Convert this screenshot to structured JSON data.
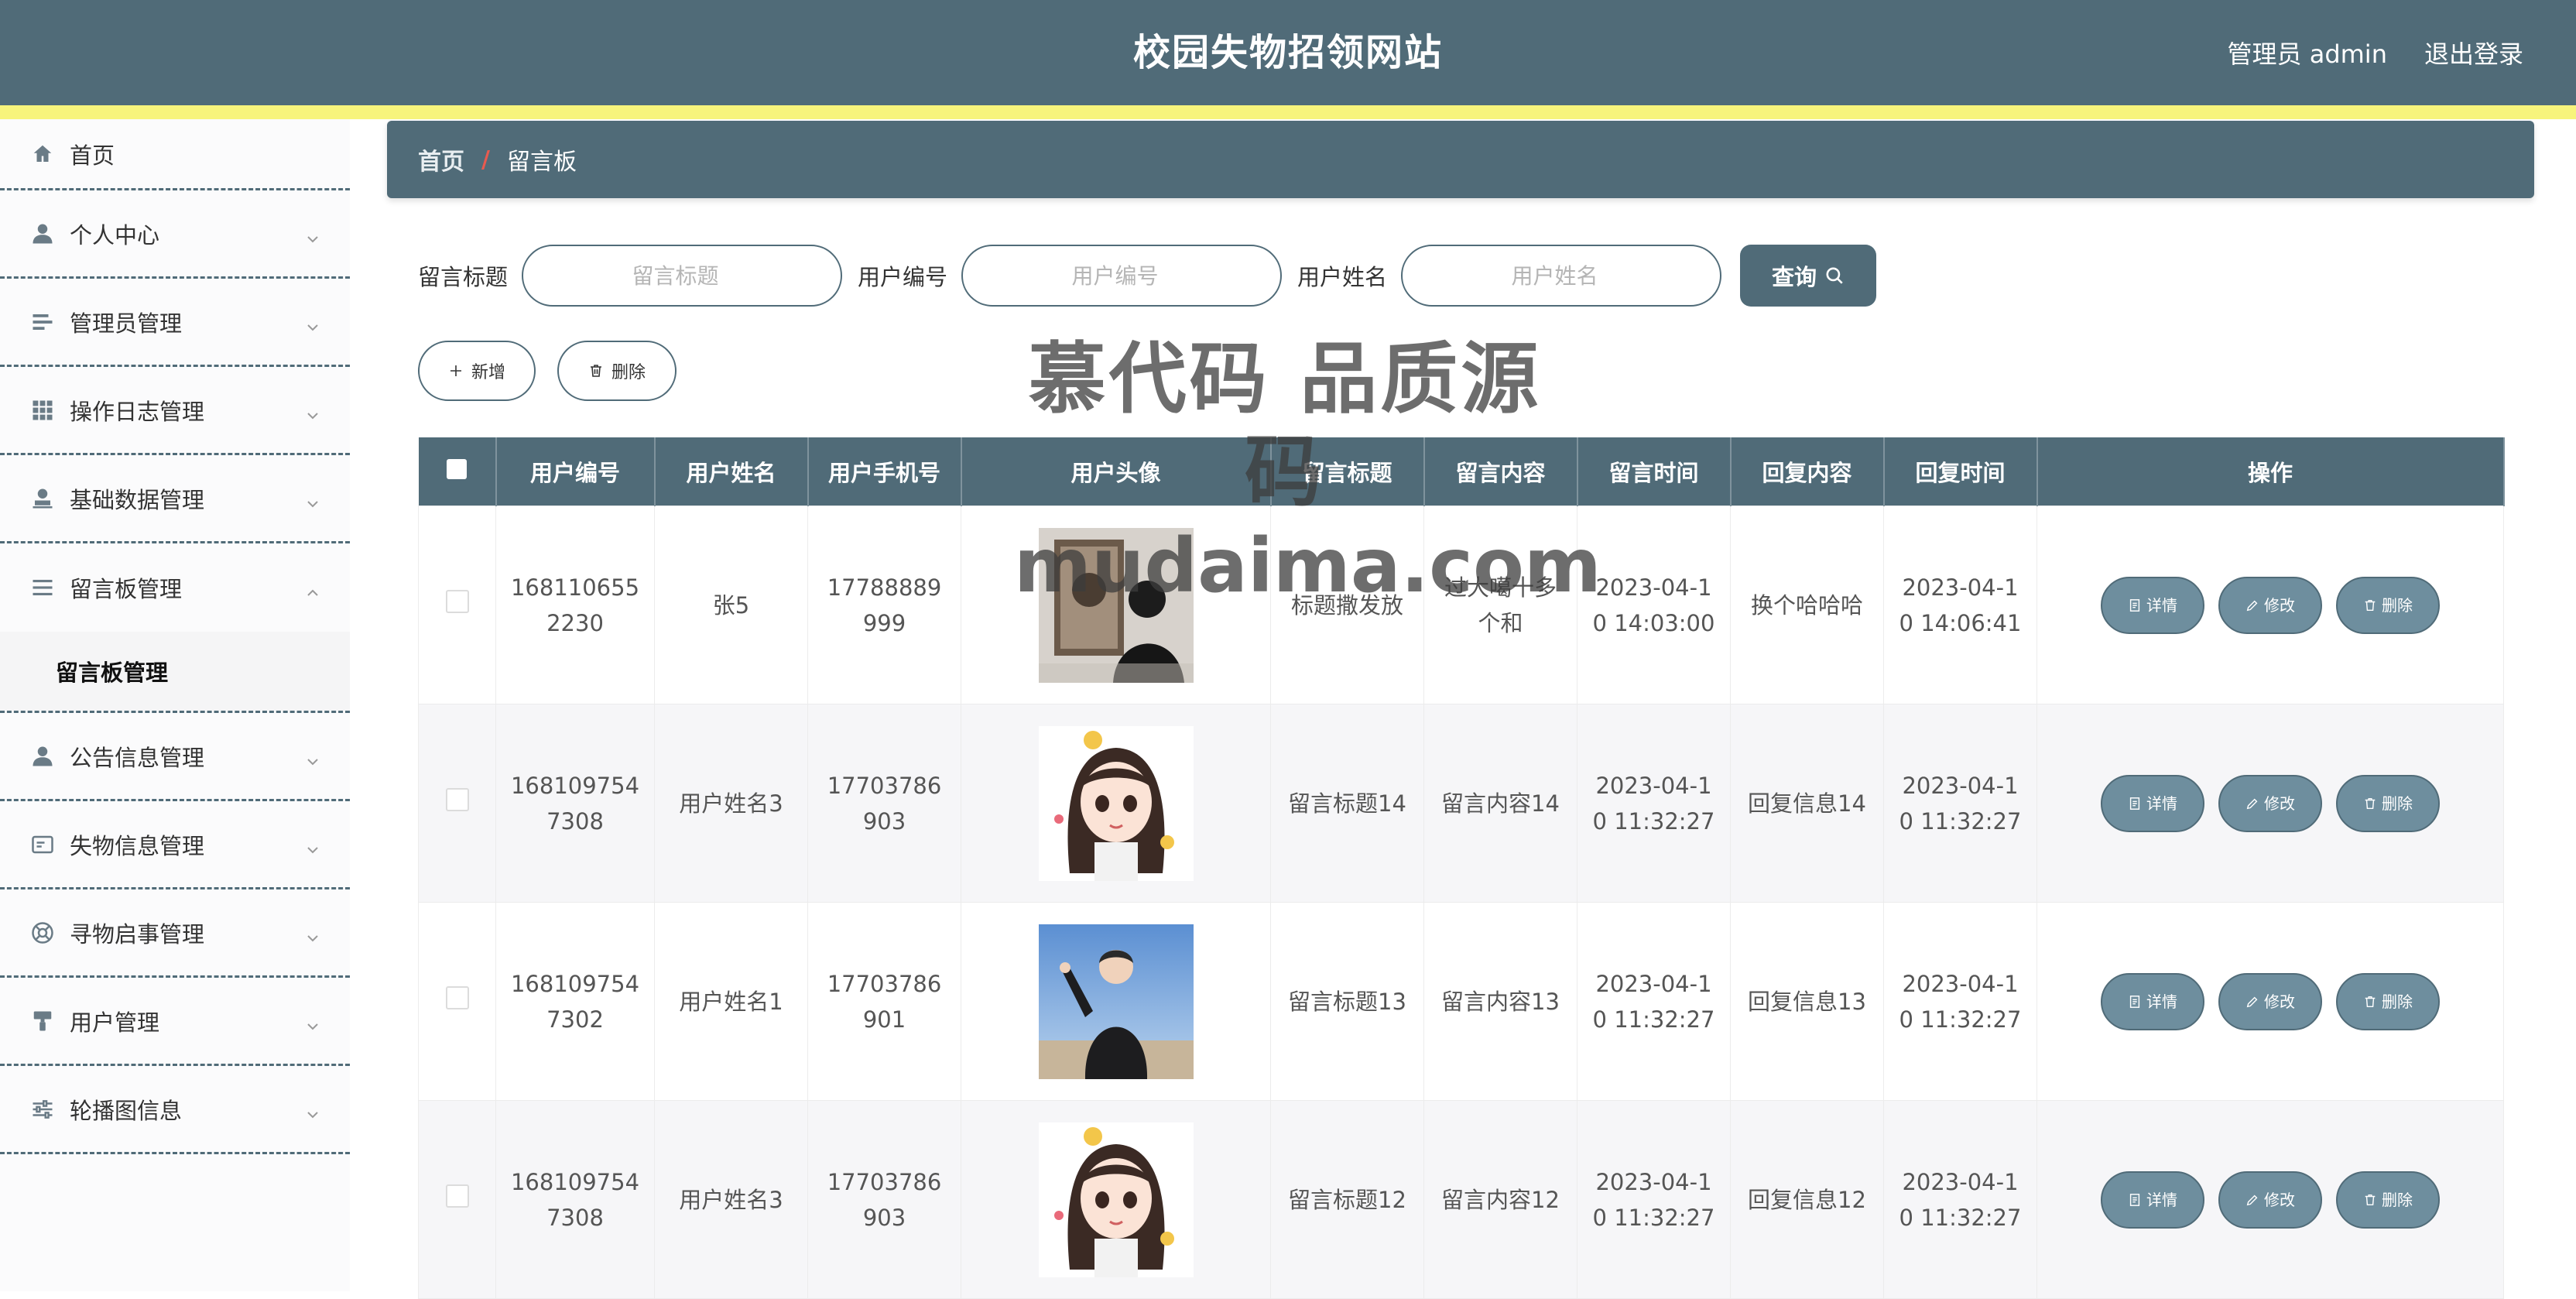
{
  "header": {
    "title": "校园失物招领网站",
    "user_label": "管理员 admin",
    "logout": "退出登录"
  },
  "colors": {
    "primary": "#506b78",
    "stripe": "#f7f47c",
    "breadcrumb_sep": "#e85a4f"
  },
  "sidebar": {
    "items": [
      {
        "label": "首页",
        "icon": "home-icon"
      },
      {
        "label": "个人中心",
        "icon": "user-icon"
      },
      {
        "label": "管理员管理",
        "icon": "sliders-icon"
      },
      {
        "label": "操作日志管理",
        "icon": "grid-icon"
      },
      {
        "label": "基础数据管理",
        "icon": "user-stamp-icon"
      },
      {
        "label": "留言板管理",
        "icon": "list-icon",
        "expanded": true,
        "children": [
          "留言板管理"
        ]
      },
      {
        "label": "公告信息管理",
        "icon": "user-icon"
      },
      {
        "label": "失物信息管理",
        "icon": "card-icon"
      },
      {
        "label": "寻物启事管理",
        "icon": "lifebuoy-icon"
      },
      {
        "label": "用户管理",
        "icon": "roller-icon"
      },
      {
        "label": "轮播图信息",
        "icon": "settings-icon"
      }
    ]
  },
  "breadcrumb": {
    "home": "首页",
    "separator": "/",
    "current": "留言板"
  },
  "search": {
    "fields": [
      {
        "label": "留言标题",
        "placeholder": "留言标题"
      },
      {
        "label": "用户编号",
        "placeholder": "用户编号"
      },
      {
        "label": "用户姓名",
        "placeholder": "用户姓名"
      }
    ],
    "button": "查询"
  },
  "actions": {
    "add": "新增",
    "delete": "删除"
  },
  "watermark": {
    "cn": "慕代码 品质源码",
    "en": "mudaima.com"
  },
  "table": {
    "columns": [
      "用户编号",
      "用户姓名",
      "用户手机号",
      "用户头像",
      "留言标题",
      "留言内容",
      "留言时间",
      "回复内容",
      "回复时间",
      "操作"
    ],
    "row_actions": {
      "detail": "详情",
      "edit": "修改",
      "delete": "删除"
    },
    "rows": [
      {
        "id": "1681106552230",
        "name": "张5",
        "phone": "17788889999",
        "avatar": "avatar-man-painting",
        "title": "标题撒发放",
        "content": "过大噶十多个和",
        "time": "2023-04-10 14:03:00",
        "reply": "换个哈哈哈",
        "reply_time": "2023-04-10 14:06:41"
      },
      {
        "id": "1681097547308",
        "name": "用户姓名3",
        "phone": "17703786903",
        "avatar": "avatar-cartoon-girl",
        "title": "留言标题14",
        "content": "留言内容14",
        "time": "2023-04-10 11:32:27",
        "reply": "回复信息14",
        "reply_time": "2023-04-10 11:32:27"
      },
      {
        "id": "1681097547302",
        "name": "用户姓名1",
        "phone": "17703786901",
        "avatar": "avatar-boy-beach",
        "title": "留言标题13",
        "content": "留言内容13",
        "time": "2023-04-10 11:32:27",
        "reply": "回复信息13",
        "reply_time": "2023-04-10 11:32:27"
      },
      {
        "id": "1681097547308",
        "name": "用户姓名3",
        "phone": "17703786903",
        "avatar": "avatar-cartoon-girl",
        "title": "留言标题12",
        "content": "留言内容12",
        "time": "2023-04-10 11:32:27",
        "reply": "回复信息12",
        "reply_time": "2023-04-10 11:32:27"
      }
    ]
  }
}
